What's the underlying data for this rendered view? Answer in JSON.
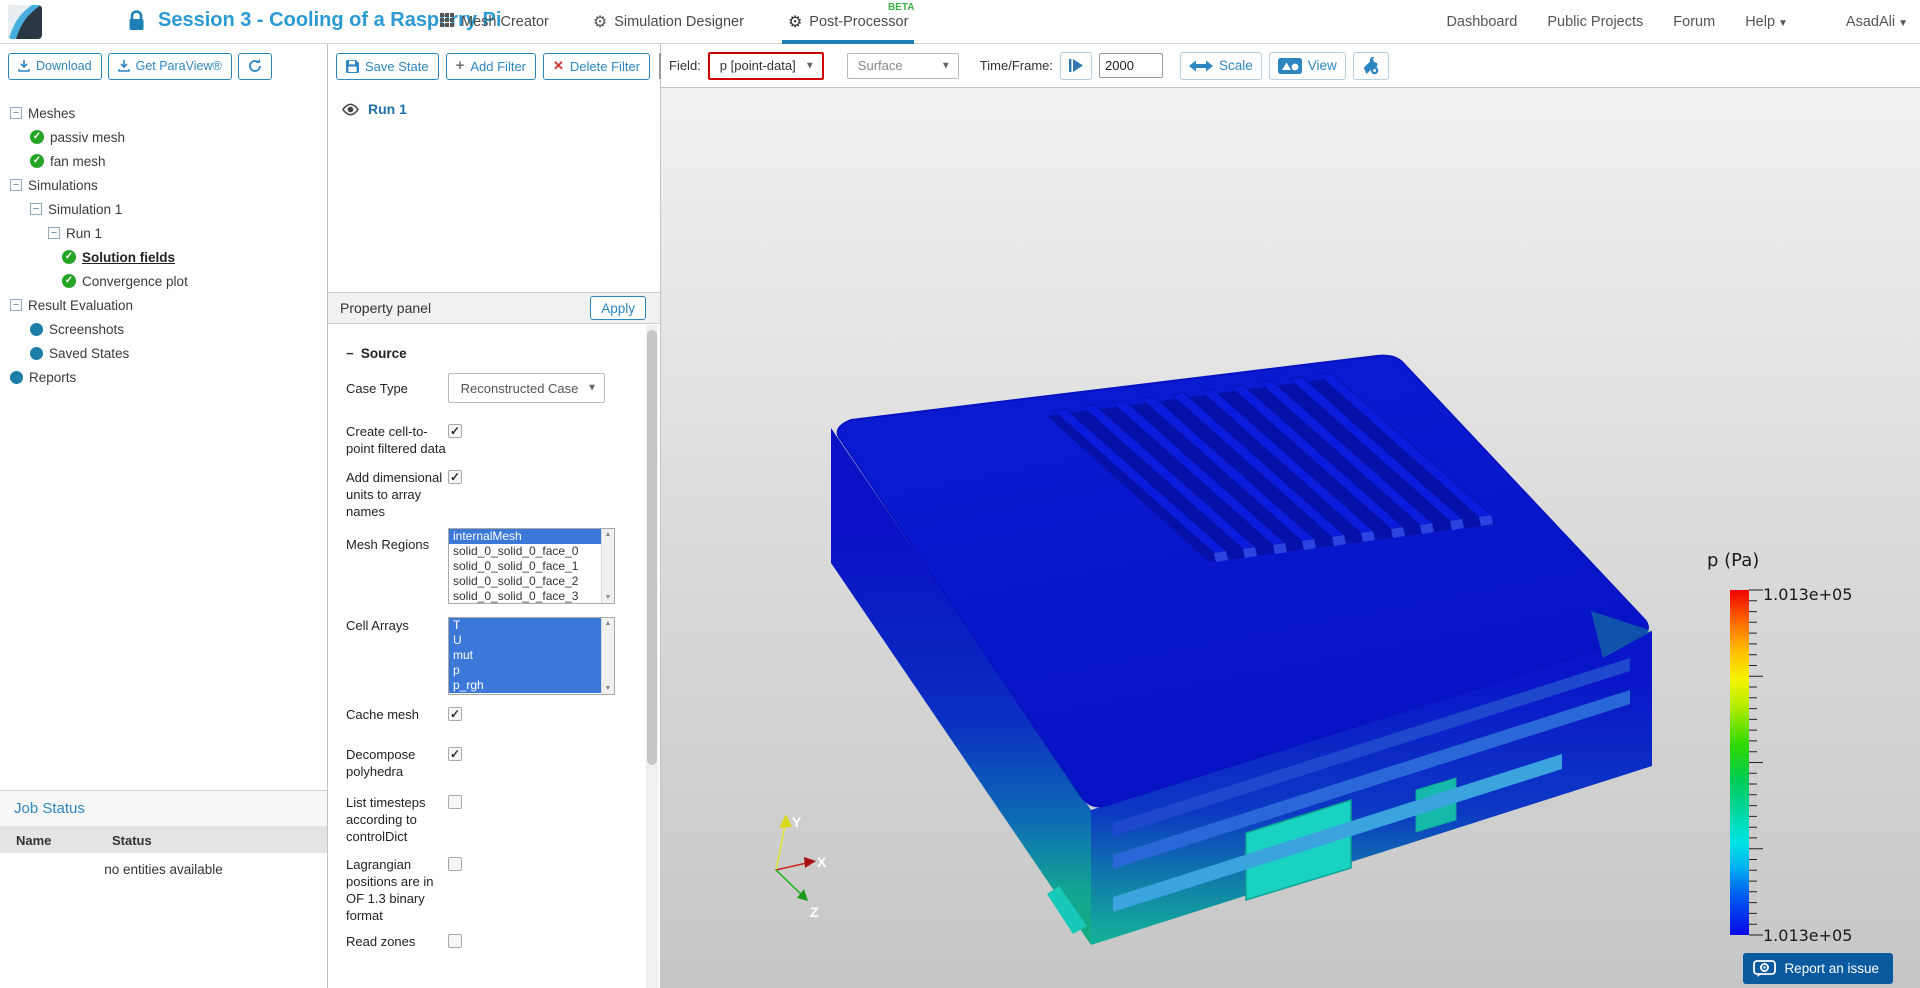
{
  "header": {
    "title": "Session 3 - Cooling of a Rasperry Pi",
    "tabs": [
      {
        "label": "Mesh Creator"
      },
      {
        "label": "Simulation Designer"
      },
      {
        "label": "Post-Processor",
        "badge": "BETA",
        "active": true
      }
    ],
    "nav": {
      "dashboard": "Dashboard",
      "public_projects": "Public Projects",
      "forum": "Forum",
      "help": "Help",
      "user": "AsadAli"
    }
  },
  "left_panel": {
    "toolbar": {
      "download": "Download",
      "get_paraview": "Get ParaView®"
    },
    "tree": [
      {
        "label": "Meshes",
        "icon": "collapse"
      },
      {
        "label": "passiv mesh",
        "icon": "check"
      },
      {
        "label": "fan mesh",
        "icon": "check"
      },
      {
        "label": "Simulations",
        "icon": "collapse"
      },
      {
        "label": "Simulation 1",
        "icon": "collapse"
      },
      {
        "label": "Run 1",
        "icon": "collapse"
      },
      {
        "label": "Solution fields",
        "icon": "check",
        "selected": true
      },
      {
        "label": "Convergence plot",
        "icon": "check"
      },
      {
        "label": "Result Evaluation",
        "icon": "collapse"
      },
      {
        "label": "Screenshots",
        "icon": "dot"
      },
      {
        "label": "Saved States",
        "icon": "dot"
      },
      {
        "label": "Reports",
        "icon": "dot"
      }
    ],
    "job_status": {
      "title": "Job Status",
      "columns": {
        "name": "Name",
        "status": "Status"
      },
      "empty_text": "no entities available"
    }
  },
  "pipeline_panel": {
    "toolbar": {
      "save_state": "Save State",
      "add_filter": "Add Filter",
      "delete_filter": "Delete Filter"
    },
    "items": [
      {
        "label": "Run 1",
        "visible": true
      }
    ],
    "property_panel": {
      "title": "Property panel",
      "apply": "Apply",
      "section": "Source",
      "case_type": {
        "label": "Case Type",
        "value": "Reconstructed Case"
      },
      "create_cell_to_point": {
        "label": "Create cell-to-point filtered data",
        "checked": true
      },
      "add_dimensional_units": {
        "label": "Add dimensional units to array names",
        "checked": true
      },
      "mesh_regions": {
        "label": "Mesh Regions",
        "options": [
          "internalMesh",
          "solid_0_solid_0_face_0",
          "solid_0_solid_0_face_1",
          "solid_0_solid_0_face_2",
          "solid_0_solid_0_face_3"
        ],
        "selected": [
          "internalMesh"
        ]
      },
      "cell_arrays": {
        "label": "Cell Arrays",
        "options": [
          "T",
          "U",
          "mut",
          "p",
          "p_rgh"
        ],
        "selected": [
          "T",
          "U",
          "mut",
          "p",
          "p_rgh"
        ]
      },
      "cache_mesh": {
        "label": "Cache mesh",
        "checked": true
      },
      "decompose_polyhedra": {
        "label": "Decompose polyhedra",
        "checked": true
      },
      "list_timesteps": {
        "label": "List timesteps according to controlDict",
        "checked": false
      },
      "lagrangian_positions": {
        "label": "Lagrangian positions are in OF 1.3 binary format",
        "checked": false
      },
      "read_zones": {
        "label": "Read zones",
        "checked": false
      }
    }
  },
  "viewport": {
    "toolbar": {
      "field_label": "Field:",
      "field_value": "p [point-data]",
      "representation": "Surface",
      "time_label": "Time/Frame:",
      "time_value": "2000",
      "scale_label": "Scale",
      "view_label": "View"
    },
    "legend": {
      "title": "p (Pa)",
      "max": "1.013e+05",
      "min": "1.013e+05"
    },
    "axes": {
      "x": "X",
      "y": "Y",
      "z": "Z"
    },
    "report_issue": "Report an issue"
  },
  "colors": {
    "brand_blue": "#2e86c1",
    "title_blue": "#2b9ad3",
    "active_tab_underline": "#1b7eb8",
    "beta_green": "#3cb44a",
    "tree_check_green": "#27a327",
    "tree_dot_blue": "#1b7fa8",
    "list_selection_blue": "#3c78d8",
    "field_alert_border": "#cf0000",
    "report_button_blue": "#0a5aa0",
    "model_top_blue": "#0815cc",
    "model_bottom_teal": "#16ad85"
  }
}
